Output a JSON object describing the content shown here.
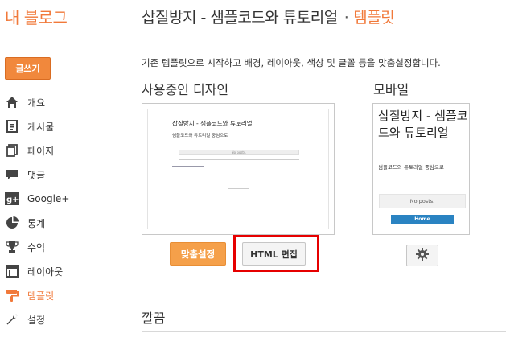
{
  "brand": "내 블로그",
  "header": {
    "blog_title": "삽질방지 - 샘플코드와 튜토리얼",
    "separator": "·",
    "section": "템플릿"
  },
  "write_button": "글쓰기",
  "nav": [
    {
      "label": "개요",
      "icon": "home-icon"
    },
    {
      "label": "게시물",
      "icon": "posts-icon"
    },
    {
      "label": "페이지",
      "icon": "pages-icon"
    },
    {
      "label": "댓글",
      "icon": "comment-icon"
    },
    {
      "label": "Google+",
      "icon": "google-plus-icon"
    },
    {
      "label": "통계",
      "icon": "stats-icon"
    },
    {
      "label": "수익",
      "icon": "trophy-icon"
    },
    {
      "label": "레이아웃",
      "icon": "layout-icon"
    },
    {
      "label": "템플릿",
      "icon": "template-icon",
      "active": true
    },
    {
      "label": "설정",
      "icon": "wrench-icon"
    }
  ],
  "description": "기존 템플릿으로 시작하고 배경, 레이아웃, 색상 및 글꼴 등을 맞춤설정합니다.",
  "current_design": {
    "label": "사용중인 디자인",
    "preview_title": "삽질방지 - 샘플코드와 튜토리얼",
    "preview_subtitle": "샘플코드와 튜토리얼 중심으로",
    "preview_box": "No posts."
  },
  "mobile": {
    "label": "모바일",
    "preview_title": "삽질방지 - 샘플코드와 튜토리얼",
    "preview_subtitle": "샘플코드와 튜토리얼 중심으로",
    "no_posts": "No posts.",
    "home": "Home"
  },
  "buttons": {
    "customize": "맞춤설정",
    "edit_html": "HTML 편집"
  },
  "clean_section": "깔끔",
  "colors": {
    "accent": "#f1793a",
    "highlight": "#e60000"
  }
}
